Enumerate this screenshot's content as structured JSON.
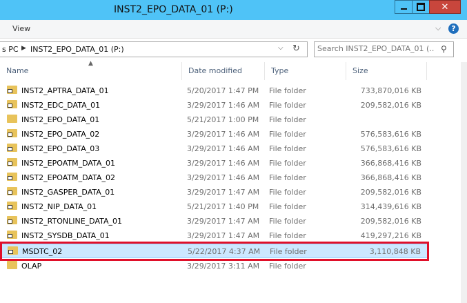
{
  "window": {
    "title": "INST2_EPO_DATA_01 (P:)"
  },
  "ribbon": {
    "view_label": "View"
  },
  "address": {
    "crumb1": "s PC",
    "crumb2": "INST2_EPO_DATA_01 (P:)"
  },
  "search": {
    "placeholder": "Search INST2_EPO_DATA_01 (..."
  },
  "columns": {
    "name": "Name",
    "date": "Date modified",
    "type": "Type",
    "size": "Size"
  },
  "files": [
    {
      "name": "INST2_APTRA_DATA_01",
      "date": "5/20/2017 1:47 PM",
      "type": "File folder",
      "size": "733,870,016 KB"
    },
    {
      "name": "INST2_EDC_DATA_01",
      "date": "3/29/2017 1:46 AM",
      "type": "File folder",
      "size": "209,582,016 KB"
    },
    {
      "name": "INST2_EPO_DATA_01",
      "date": "5/21/2017 1:00 PM",
      "type": "File folder",
      "size": ""
    },
    {
      "name": "INST2_EPO_DATA_02",
      "date": "3/29/2017 1:46 AM",
      "type": "File folder",
      "size": "576,583,616 KB"
    },
    {
      "name": "INST2_EPO_DATA_03",
      "date": "3/29/2017 1:46 AM",
      "type": "File folder",
      "size": "576,583,616 KB"
    },
    {
      "name": "INST2_EPOATM_DATA_01",
      "date": "3/29/2017 1:46 AM",
      "type": "File folder",
      "size": "366,868,416 KB"
    },
    {
      "name": "INST2_EPOATM_DATA_02",
      "date": "3/29/2017 1:46 AM",
      "type": "File folder",
      "size": "366,868,416 KB"
    },
    {
      "name": "INST2_GASPER_DATA_01",
      "date": "3/29/2017 1:47 AM",
      "type": "File folder",
      "size": "209,582,016 KB"
    },
    {
      "name": "INST2_NIP_DATA_01",
      "date": "5/21/2017 1:40 PM",
      "type": "File folder",
      "size": "314,439,616 KB"
    },
    {
      "name": "INST2_RTONLINE_DATA_01",
      "date": "3/29/2017 1:47 AM",
      "type": "File folder",
      "size": "209,582,016 KB"
    },
    {
      "name": "INST2_SYSDB_DATA_01",
      "date": "3/29/2017 1:47 AM",
      "type": "File folder",
      "size": "419,297,216 KB"
    },
    {
      "name": "MSDTC_02",
      "date": "5/22/2017 4:37 AM",
      "type": "File folder",
      "size": "3,110,848 KB"
    },
    {
      "name": "OLAP",
      "date": "3/29/2017 3:11 AM",
      "type": "File folder",
      "size": ""
    }
  ],
  "colors": {
    "titlebar": "#4fc3f7",
    "highlight": "#e0102a",
    "selected": "#cce8ff"
  }
}
